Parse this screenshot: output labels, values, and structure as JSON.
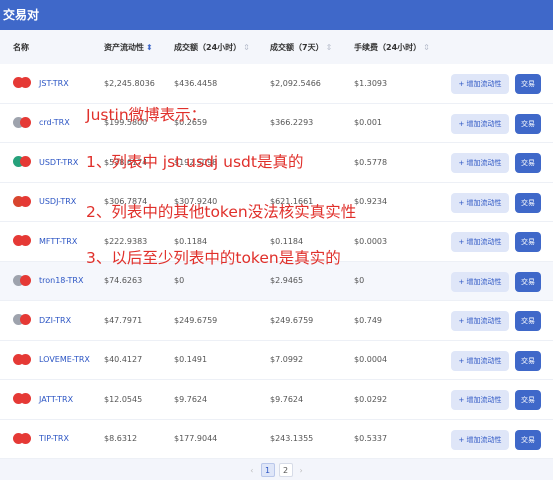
{
  "header": {
    "title": "交易对"
  },
  "columns": {
    "name": "名称",
    "liquidity": "资产流动性",
    "volume24h": "成交额（24小时）",
    "volume7d": "成交额（7天）",
    "fee24h": "手续费（24小时）"
  },
  "sort_glyphs": {
    "active": "⬍",
    "inactive": "⇕"
  },
  "buttons": {
    "add_liquidity": "+ 增加流动性",
    "trade": "交易"
  },
  "rows": [
    {
      "pair": "JST-TRX",
      "liquidity": "$2,245.8036",
      "vol24": "$436.4458",
      "vol7": "$2,092.5466",
      "fee": "$1.3093",
      "icon1_color": "#e53935",
      "icon2_color": "#e53935"
    },
    {
      "pair": "crd-TRX",
      "liquidity": "$199.5800",
      "vol24": "$0.2659",
      "vol7": "$366.2293",
      "fee": "$0.001",
      "icon1_color": "#9ea3ad",
      "icon2_color": "#e53935"
    },
    {
      "pair": "USDT-TRX",
      "liquidity": "$538.6174",
      "vol24": "$192.5098",
      "vol7": "",
      "fee": "$0.5778",
      "icon1_color": "#26a17b",
      "icon2_color": "#e53935"
    },
    {
      "pair": "USDJ-TRX",
      "liquidity": "$306.7874",
      "vol24": "$307.9240",
      "vol7": "$621.1661",
      "fee": "$0.9234",
      "icon1_color": "#d8452e",
      "icon2_color": "#e53935"
    },
    {
      "pair": "MFTT-TRX",
      "liquidity": "$222.9383",
      "vol24": "$0.1184",
      "vol7": "$0.1184",
      "fee": "$0.0003",
      "icon1_color": "#e53935",
      "icon2_color": "#e53935"
    },
    {
      "pair": "tron18-TRX",
      "liquidity": "$74.6263",
      "vol24": "$0",
      "vol7": "$2.9465",
      "fee": "$0",
      "icon1_color": "#9ea3ad",
      "icon2_color": "#e53935"
    },
    {
      "pair": "DZI-TRX",
      "liquidity": "$47.7971",
      "vol24": "$249.6759",
      "vol7": "$249.6759",
      "fee": "$0.749",
      "icon1_color": "#9ea3ad",
      "icon2_color": "#e53935"
    },
    {
      "pair": "LOVEME-TRX",
      "liquidity": "$40.4127",
      "vol24": "$0.1491",
      "vol7": "$7.0992",
      "fee": "$0.0004",
      "icon1_color": "#e53935",
      "icon2_color": "#e53935"
    },
    {
      "pair": "JATT-TRX",
      "liquidity": "$12.0545",
      "vol24": "$9.7624",
      "vol7": "$9.7624",
      "fee": "$0.0292",
      "icon1_color": "#e53935",
      "icon2_color": "#e53935"
    },
    {
      "pair": "TIP-TRX",
      "liquidity": "$8.6312",
      "vol24": "$177.9044",
      "vol7": "$243.1355",
      "fee": "$0.5337",
      "icon1_color": "#e53935",
      "icon2_color": "#e53935"
    }
  ],
  "annotations": {
    "line0": "Justin微博表示：",
    "line1": "1、列表中 jst usdj usdt是真的",
    "line2": "2、列表中的其他token没法核实真实性",
    "line3": "3、以后至少列表中的token是真实的"
  },
  "pagination": {
    "prev": "‹",
    "next": "›",
    "pages": [
      "1",
      "2"
    ],
    "current": "1"
  },
  "colors": {
    "accent": "#3f68c9",
    "annotation": "#e0302b"
  }
}
